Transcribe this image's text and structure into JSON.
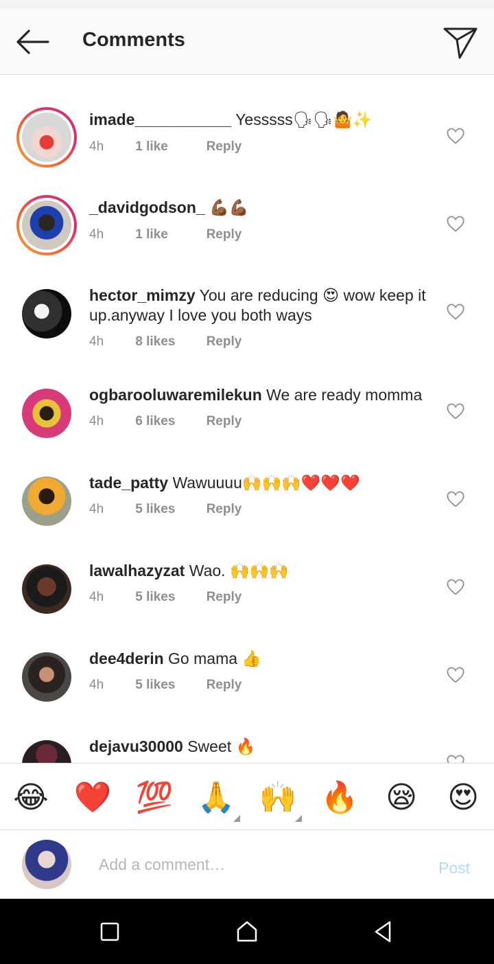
{
  "header": {
    "title": "Comments"
  },
  "comments": [
    {
      "user": "imade___________",
      "text": "Yesssss🗣🗣🤷✨",
      "time": "4h",
      "likes": "1 like",
      "reply": "Reply",
      "has_story_ring": true
    },
    {
      "user": "_davidgodson_",
      "text": "💪🏾💪🏾",
      "time": "4h",
      "likes": "1 like",
      "reply": "Reply",
      "has_story_ring": true
    },
    {
      "user": "hector_mimzy",
      "text": "You are reducing 😍 wow keep it up.anyway I love you both ways",
      "time": "4h",
      "likes": "8 likes",
      "reply": "Reply",
      "has_story_ring": false
    },
    {
      "user": "ogbarooluwaremilekun",
      "text": "We are ready momma",
      "time": "4h",
      "likes": "6 likes",
      "reply": "Reply",
      "has_story_ring": false
    },
    {
      "user": "tade_patty",
      "text": "Wawuuuu🙌🙌🙌❤️❤️❤️",
      "time": "4h",
      "likes": "5 likes",
      "reply": "Reply",
      "has_story_ring": false
    },
    {
      "user": "lawalhazyzat",
      "text": "Wao. 🙌🙌🙌",
      "time": "4h",
      "likes": "5 likes",
      "reply": "Reply",
      "has_story_ring": false
    },
    {
      "user": "dee4derin",
      "text": "Go mama 👍",
      "time": "4h",
      "likes": "5 likes",
      "reply": "Reply",
      "has_story_ring": false
    },
    {
      "user": "dejavu30000",
      "text": "Sweet 🔥",
      "time": "",
      "likes": "",
      "reply": "",
      "has_story_ring": false
    }
  ],
  "quick_emojis": [
    "😂",
    "❤️",
    "💯",
    "🙏",
    "🙌",
    "🔥",
    "😪",
    "😍"
  ],
  "compose": {
    "placeholder": "Add a comment…",
    "post_label": "Post"
  },
  "colors": {
    "story_ring_start": "#f9a03a",
    "story_ring_end": "#c13584",
    "post_disabled": "#b3dbff",
    "meta_gray": "#8e8e8e"
  }
}
